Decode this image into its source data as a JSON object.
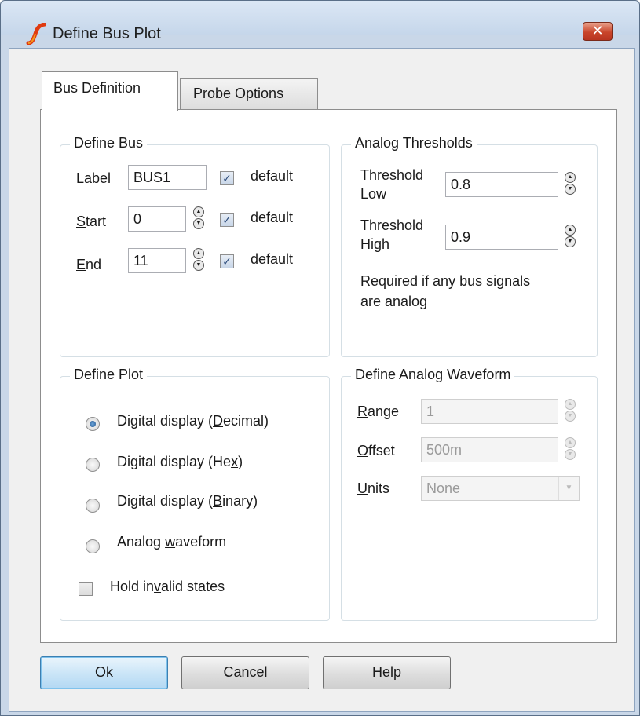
{
  "window": {
    "title": "Define Bus Plot",
    "close_symbol": "✕"
  },
  "tabs": [
    {
      "label": "Bus Definition"
    },
    {
      "label": "Probe Options"
    }
  ],
  "define_bus": {
    "title": "Define Bus",
    "label": {
      "key": "L",
      "rest": "abel",
      "value": "BUS1",
      "default_label": "default",
      "default_checked": true
    },
    "start": {
      "key": "S",
      "rest": "tart",
      "value": "0",
      "default_label": "default",
      "default_checked": true
    },
    "end": {
      "key": "E",
      "rest": "nd",
      "value": "11",
      "default_label": "default",
      "default_checked": true
    }
  },
  "analog_thresholds": {
    "title": "Analog Thresholds",
    "low_line1": "Threshold",
    "low_line2": "Low",
    "low_value": "0.8",
    "high_line1": "Threshold",
    "high_line2": "High",
    "high_value": "0.9",
    "note_line1": "Required if any bus signals",
    "note_line2": "are analog"
  },
  "define_plot": {
    "title": "Define Plot",
    "options": [
      {
        "pre": "Digital display (",
        "key": "D",
        "post": "ecimal)",
        "selected": true
      },
      {
        "pre": "Digital display (He",
        "key": "x",
        "post": ")",
        "selected": false
      },
      {
        "pre": "Digital display (",
        "key": "B",
        "post": "inary)",
        "selected": false
      },
      {
        "pre": "Analog ",
        "key": "w",
        "post": "aveform",
        "selected": false
      }
    ],
    "hold_invalid": {
      "pre": "Hold in",
      "key": "v",
      "post": "alid states",
      "checked": false
    }
  },
  "analog_waveform": {
    "title": "Define Analog Waveform",
    "range": {
      "key": "R",
      "rest": "ange",
      "value": "1"
    },
    "offset": {
      "key": "O",
      "rest": "ffset",
      "value": "500m"
    },
    "units": {
      "key": "U",
      "rest": "nits",
      "value": "None"
    }
  },
  "buttons": {
    "ok": {
      "key": "O",
      "rest": "k"
    },
    "cancel": {
      "key": "C",
      "rest": "ancel"
    },
    "help": {
      "key": "H",
      "rest": "elp"
    }
  },
  "icons": [
    "simetrix-logo-icon",
    "close-icon",
    "spin-up-icon",
    "spin-down-icon",
    "checkmark-icon",
    "dropdown-arrow-icon"
  ]
}
